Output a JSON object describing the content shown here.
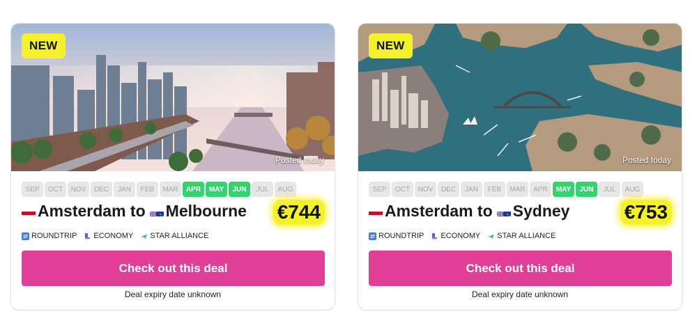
{
  "months": [
    "SEP",
    "OCT",
    "NOV",
    "DEC",
    "JAN",
    "FEB",
    "MAR",
    "APR",
    "MAY",
    "JUN",
    "JUL",
    "AUG"
  ],
  "deals": [
    {
      "badge": "NEW",
      "posted": "Posted today",
      "active_months": [
        "APR",
        "MAY",
        "JUN"
      ],
      "origin": "Amsterdam to",
      "destination": "Melbourne",
      "price": "€744",
      "tags": [
        "ROUNDTRIP",
        "ECONOMY",
        "STAR ALLIANCE"
      ],
      "cta_label": "Check out this deal",
      "expiry": "Deal expiry date unknown"
    },
    {
      "badge": "NEW",
      "posted": "Posted today",
      "active_months": [
        "MAY",
        "JUN"
      ],
      "origin": "Amsterdam to",
      "destination": "Sydney",
      "price": "€753",
      "tags": [
        "ROUNDTRIP",
        "ECONOMY",
        "STAR ALLIANCE"
      ],
      "cta_label": "Check out this deal",
      "expiry": "Deal expiry date unknown"
    }
  ],
  "colors": {
    "badge": "#f4f12a",
    "cta": "#e03e97",
    "month_active": "#33d46f",
    "month_inactive": "#e7e7e7"
  },
  "icons": {
    "flag_origin": "netherlands-flag-icon",
    "flag_destination": "australia-flag-icon",
    "roundtrip": "roundtrip-icon",
    "economy": "seat-icon",
    "alliance": "airplane-icon"
  }
}
